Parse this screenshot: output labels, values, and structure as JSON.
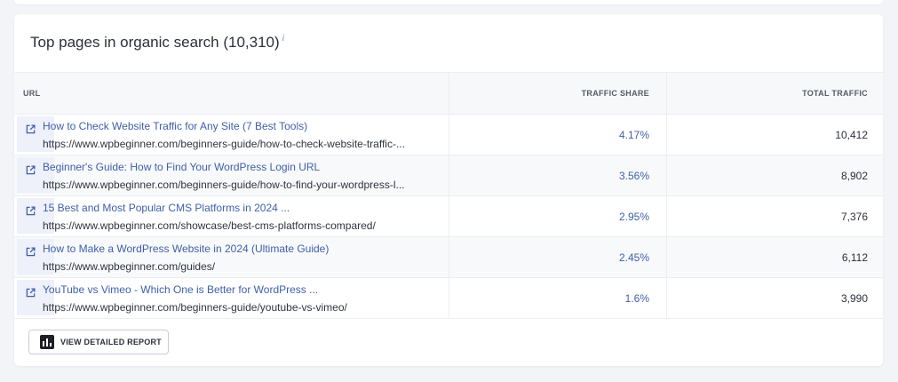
{
  "card": {
    "title": "Top pages in organic search (10,310)",
    "info_glyph": "i"
  },
  "table": {
    "columns": {
      "url": "URL",
      "traffic_share": "TRAFFIC SHARE",
      "total_traffic": "TOTAL TRAFFIC"
    },
    "rows": [
      {
        "title": "How to Check Website Traffic for Any Site (7 Best Tools)",
        "url": "https://www.wpbeginner.com/beginners-guide/how-to-check-website-traffic-...",
        "traffic_share": "4.17%",
        "total_traffic": "10,412"
      },
      {
        "title": "Beginner's Guide: How to Find Your WordPress Login URL",
        "url": "https://www.wpbeginner.com/beginners-guide/how-to-find-your-wordpress-l...",
        "traffic_share": "3.56%",
        "total_traffic": "8,902"
      },
      {
        "title": "15 Best and Most Popular CMS Platforms in 2024 ...",
        "url": "https://www.wpbeginner.com/showcase/best-cms-platforms-compared/",
        "traffic_share": "2.95%",
        "total_traffic": "7,376"
      },
      {
        "title": "How to Make a WordPress Website in 2024 (Ultimate Guide)",
        "url": "https://www.wpbeginner.com/guides/",
        "traffic_share": "2.45%",
        "total_traffic": "6,112"
      },
      {
        "title": "YouTube vs Vimeo - Which One is Better for WordPress ...",
        "url": "https://www.wpbeginner.com/beginners-guide/youtube-vs-vimeo/",
        "traffic_share": "1.6%",
        "total_traffic": "3,990"
      }
    ]
  },
  "actions": {
    "view_report_label": "VIEW DETAILED REPORT"
  },
  "icons": {
    "row_link": "external-link-icon",
    "report": "bar-chart-icon",
    "title_info": "info-icon"
  },
  "colors": {
    "link": "#3f5fa8",
    "text": "#2a2f3a",
    "background": "#f3f4f7"
  }
}
